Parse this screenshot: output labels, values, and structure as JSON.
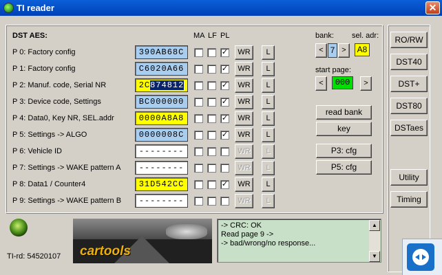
{
  "window": {
    "title": "TI reader",
    "close_glyph": "✕"
  },
  "dst": {
    "heading": "DST AES:",
    "col_ma": "MA",
    "col_lf": "LF",
    "col_pl": "PL",
    "rows": [
      {
        "label": "P 0: Factory config",
        "hex": "390AB68C",
        "bg": "#a9cdef",
        "ma": false,
        "lf": false,
        "pl": true,
        "wr_enabled": true
      },
      {
        "label": "P 1: Factory config",
        "hex": "C6020A66",
        "bg": "#a9cdef",
        "ma": false,
        "lf": false,
        "pl": true,
        "wr_enabled": true
      },
      {
        "label": "P 2: Manuf. code, Serial NR",
        "hex_prefix": "2C",
        "hex_rest": "874812",
        "bg": "#ffff00",
        "ma": false,
        "lf": false,
        "pl": true,
        "wr_enabled": true
      },
      {
        "label": "P 3: Device code, Settings",
        "hex": "BC000000",
        "bg": "#a9cdef",
        "ma": false,
        "lf": false,
        "pl": true,
        "wr_enabled": true
      },
      {
        "label": "P 4: Data0, Key NR, SEL.addr",
        "hex": "0000A8A8",
        "bg": "#ffff00",
        "ma": false,
        "lf": false,
        "pl": true,
        "wr_enabled": true
      },
      {
        "label": "P 5: Settings -> ALGO",
        "hex": "0000008C",
        "bg": "#a9cdef",
        "ma": false,
        "lf": false,
        "pl": true,
        "wr_enabled": true
      },
      {
        "label": "P 6: Vehicle ID",
        "hex": "--------",
        "bg": "#ffffff",
        "ma": false,
        "lf": false,
        "pl": false,
        "wr_enabled": false
      },
      {
        "label": "P 7: Settings -> WAKE pattern A",
        "hex": "--------",
        "bg": "#ffffff",
        "ma": false,
        "lf": false,
        "pl": false,
        "wr_enabled": false
      },
      {
        "label": "P 8: Data1 / Counter4",
        "hex": "31D542CC",
        "bg": "#ffff00",
        "ma": false,
        "lf": false,
        "pl": true,
        "wr_enabled": true
      },
      {
        "label": "P 9: Settings -> WAKE pattern B",
        "hex": "--------",
        "bg": "#ffffff",
        "ma": false,
        "lf": false,
        "pl": false,
        "wr_enabled": false
      }
    ],
    "wr_label": "WR",
    "l_label": "L",
    "check_glyph": "✓"
  },
  "bank": {
    "label": "bank:",
    "value": "7",
    "prev": "<",
    "next": ">"
  },
  "sel_adr": {
    "label": "sel. adr:",
    "value": "A8"
  },
  "start_page": {
    "label": "start page:",
    "value": "000",
    "prev": "<",
    "next": ">"
  },
  "actions": {
    "read_bank": "read bank",
    "key": "key",
    "p3_cfg": "P3: cfg",
    "p5_cfg": "P5: cfg"
  },
  "sidebar": {
    "rorw": "RO/RW",
    "dst40": "DST40",
    "dstplus": "DST+",
    "dst80": "DST80",
    "dstaes": "DSTaes",
    "utility": "Utility",
    "timing": "Timing"
  },
  "status": {
    "ti_rd": "TI-rd: 54520107"
  },
  "logo": {
    "text": "cartools"
  },
  "console": {
    "lines": [
      "-> CRC: OK",
      "Read page   9 ->",
      "-> bad/wrong/no response..."
    ]
  },
  "colors": {
    "hex_blue": "#a9cdef",
    "hex_yellow": "#ffff00",
    "hex_white": "#ffffff",
    "start_page_green": "#00e000",
    "selection": "#0a246a",
    "console_bg": "#c8e0c8"
  }
}
